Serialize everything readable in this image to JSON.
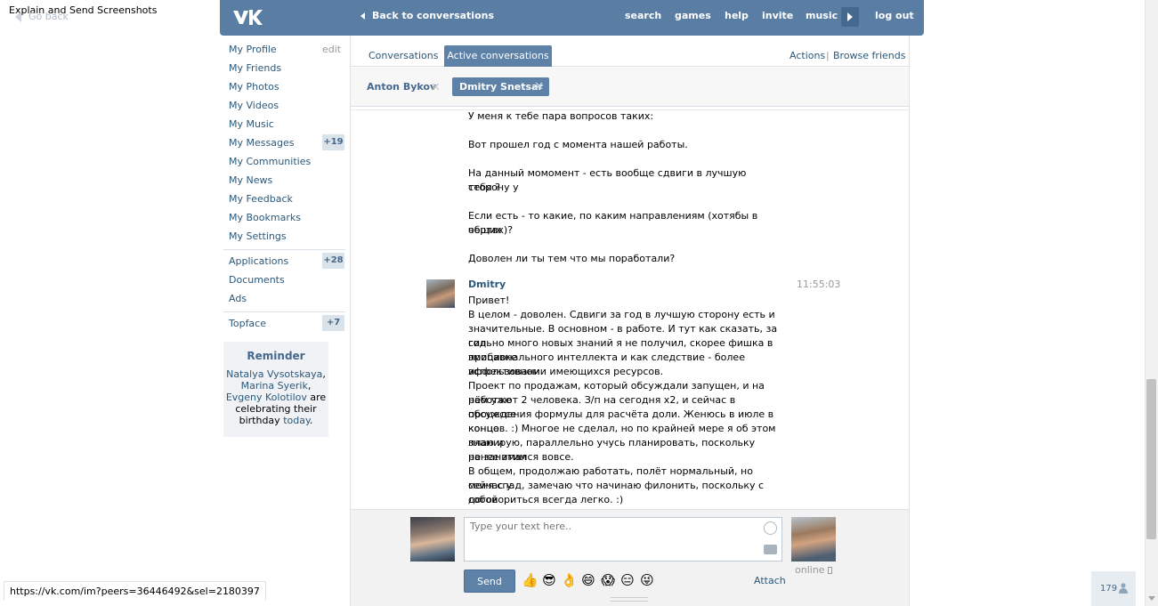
{
  "overlay": {
    "title": "Explain and Send Screenshots",
    "go_back": "Go back"
  },
  "header": {
    "back_label": "Back to conversations",
    "nav": [
      "search",
      "games",
      "help",
      "invite",
      "music"
    ],
    "logout": "log out",
    "brand_color": "#597da3"
  },
  "sidebar": {
    "edit": "edit",
    "items": [
      {
        "label": "My Profile"
      },
      {
        "label": "My Friends"
      },
      {
        "label": "My Photos"
      },
      {
        "label": "My Videos"
      },
      {
        "label": "My Music"
      },
      {
        "label": "My Messages",
        "badge": "+19"
      },
      {
        "label": "My Communities"
      },
      {
        "label": "My News"
      },
      {
        "label": "My Feedback"
      },
      {
        "label": "My Bookmarks"
      },
      {
        "label": "My Settings"
      },
      {
        "label": "Applications",
        "badge": "+28"
      },
      {
        "label": "Documents"
      },
      {
        "label": "Ads"
      },
      {
        "label": "Topface",
        "badge": "+7"
      }
    ],
    "reminder": {
      "title": "Reminder",
      "names": [
        "Natalya Vysotskaya",
        "Marina Syerik",
        "Evgeny Kolotilov"
      ],
      "sep": ",",
      "text1": "are celebrating their birthday",
      "today": "today",
      "period": "."
    }
  },
  "tabs": {
    "conversations": "Conversations",
    "active": "Active conversations",
    "actions": "Actions",
    "pipe": "|",
    "browse": "Browse friends"
  },
  "peers": [
    {
      "name": "Anton Bykov"
    },
    {
      "name": "Dmitry Snetsar"
    }
  ],
  "messages": {
    "previous_lines": [
      "У меня к тебе пара вопросов таких:",
      "Вот прошел год с момента нашей работы.",
      "На данный момомент - есть вообще сдвиги в лучшую сторону у",
      "тебя ?",
      "Если есть - то какие, по каким направлениям (хотябы в общих",
      "чертах)?",
      "Доволен ли ты тем что мы поработали?"
    ],
    "reply": {
      "author": "Dmitry",
      "time": "11:55:03",
      "lines": [
        "Привет!",
        "В целом - доволен. Сдвиги за год в лучшую сторону есть и",
        "значительные. В основном - в работе. И тут как сказать, за год",
        "сильно много новых знаний я не получил, скорее фишка в прибавке",
        "эмоционального интеллекта и как следствие - более эффективном",
        "использовании имеющихся ресурсов.",
        "Проект по продажам, который обсуждали запущен, и на нём уже",
        "работают 2 человека. З/п на сегодня х2, и сейчас в процессе",
        "обсуждения формулы для расчёта доли. Женюсь в июле в конце",
        "концов. :) Многое не сделал, но по крайней мере я об этом знаю и",
        "планирую, параллельно учусь планировать, поскольку ранее этим",
        "не занимался вовсе.",
        "В общем, продолжаю работать, полёт нормальный, но сейчас у",
        "меня спад, замечаю что начинаю филонить, поскольку с собой",
        "договориться всегда легко. :)"
      ]
    }
  },
  "composer": {
    "placeholder": "Type your text here..",
    "send": "Send",
    "attach": "Attach",
    "online": "online",
    "emojis": [
      "👍",
      "😎",
      "👌",
      "😄",
      "😱",
      "😑",
      "😜"
    ]
  },
  "status_url": "https://vk.com/im?peers=36446492&sel=2180397",
  "counter": "179"
}
